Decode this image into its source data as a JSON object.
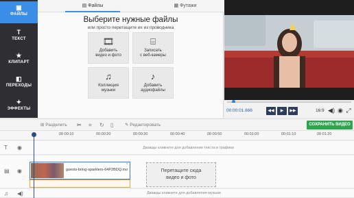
{
  "sidebar": {
    "items": [
      {
        "label": "ФАЙЛЫ",
        "icon": "file-icon",
        "active": true
      },
      {
        "label": "ТЕКСТ",
        "icon": "text-icon"
      },
      {
        "label": "КЛИПАРТ",
        "icon": "star-icon"
      },
      {
        "label": "ПЕРЕХОДЫ",
        "icon": "transitions-icon"
      },
      {
        "label": "ЭФФЕКТЫ",
        "icon": "magic-wand-icon"
      }
    ]
  },
  "panel": {
    "tabs": [
      {
        "label": "Файлы",
        "active": true
      },
      {
        "label": "Футажи",
        "active": false
      }
    ],
    "title": "Выберите нужные файлы",
    "subtitle": "или просто перетащите их из проводника",
    "tiles": [
      {
        "line1": "Добавить",
        "line2": "видео и фото",
        "icon": "film-icon"
      },
      {
        "line1": "Записать",
        "line2": "с веб-камеры",
        "icon": "camera-icon"
      },
      {
        "line1": "Коллекция",
        "line2": "музыки",
        "icon": "music-icon"
      },
      {
        "line1": "Добавить",
        "line2": "аудиофайлы",
        "icon": "audio-file-icon"
      }
    ]
  },
  "player": {
    "time": "00:00:01.666",
    "ratio": "16:9",
    "progress": 0.05
  },
  "toolbar": {
    "split": "Разделить",
    "edit": "Редактировать",
    "save": "СОХРАНИТЬ ВИДЕО"
  },
  "timeline": {
    "ticks": [
      "00:00:10",
      "00:00:20",
      "00:00:30",
      "00:00:40",
      "00:00:50",
      "00:01:00",
      "00:01:10",
      "00:01:20"
    ],
    "text_hint": "Дважды кликните для добавления текста и графики",
    "clip_name": "guests-bring-sparklers-64P2BDQ.mo",
    "dropzone_line1": "Перетащите сюда",
    "dropzone_line2": "видео и фото",
    "music_hint": "Дважды кликните для добавления музыки"
  },
  "colors": {
    "accent": "#3b8ee6",
    "save": "#2fa44f",
    "sidebar": "#2f2f33"
  }
}
